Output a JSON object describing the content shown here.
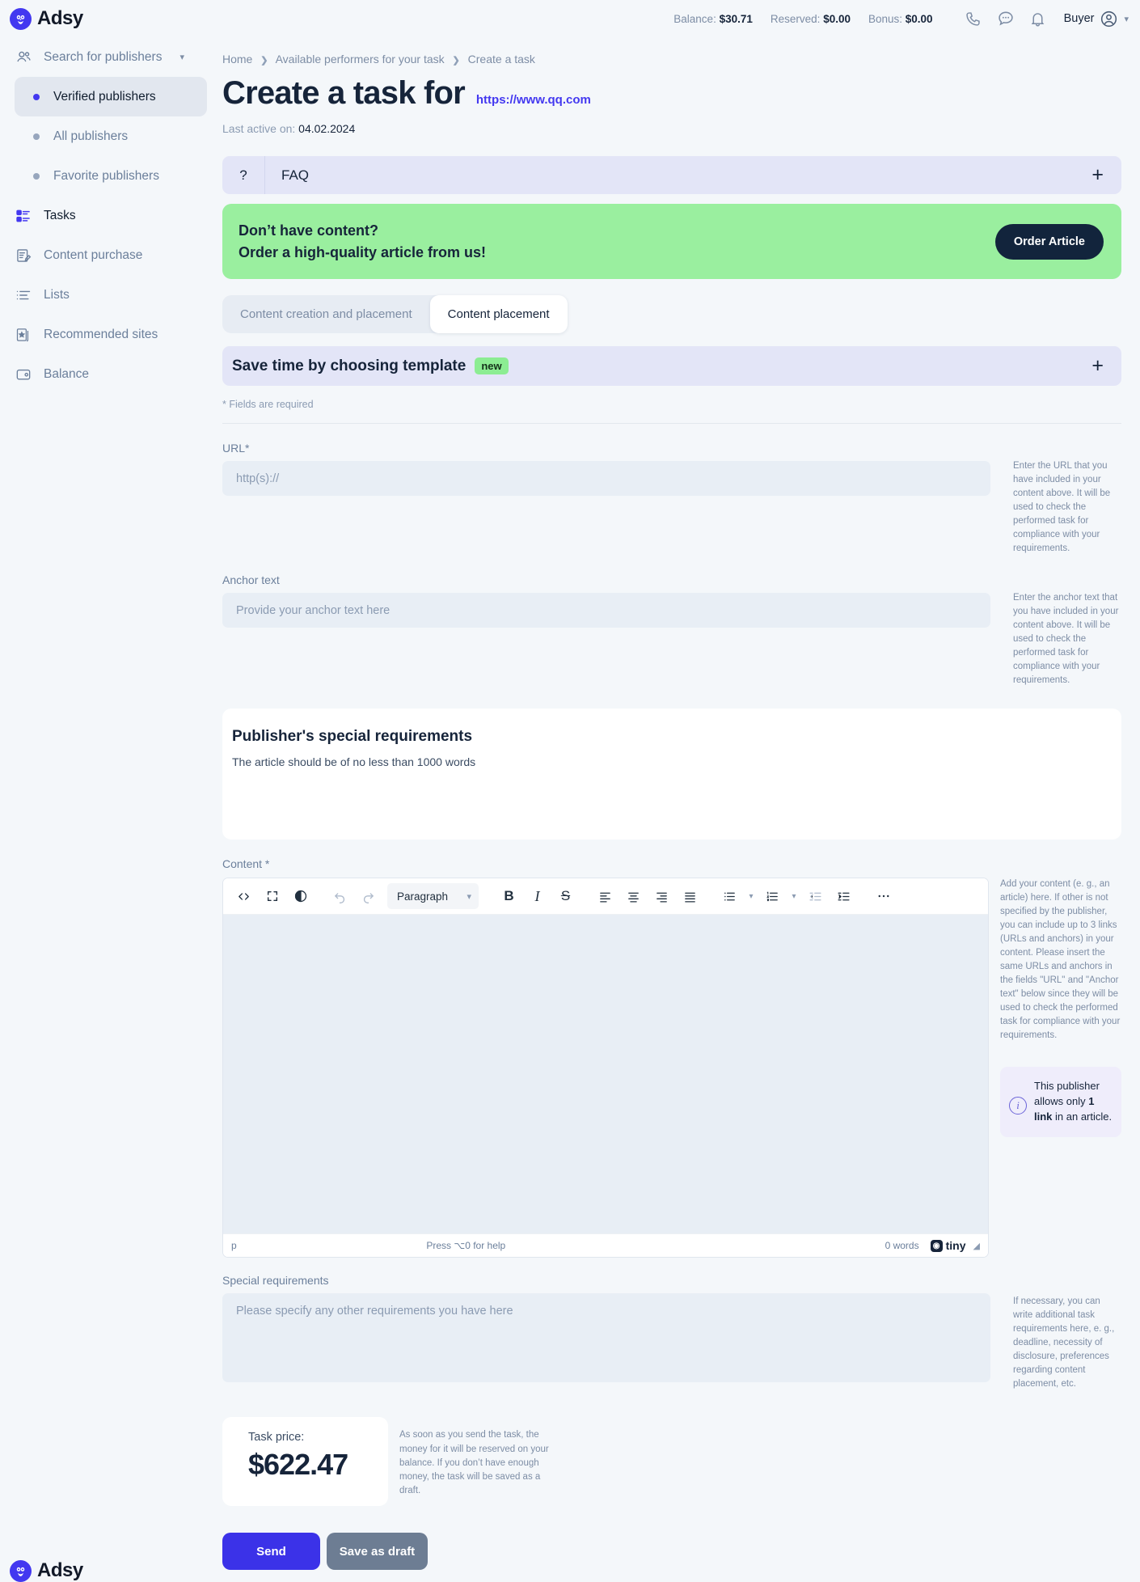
{
  "app": {
    "brand": "Adsy",
    "logo_icon": "owl-logo-icon"
  },
  "header": {
    "balance_label": "Balance:",
    "balance_value": "$30.71",
    "reserved_label": "Reserved:",
    "reserved_value": "$0.00",
    "bonus_label": "Bonus:",
    "bonus_value": "$0.00",
    "phone_icon": "phone-icon",
    "chat_icon": "chat-bubble-icon",
    "bell_icon": "bell-icon",
    "role": "Buyer",
    "avatar_icon": "user-avatar-icon",
    "chevron": "chevron-down-icon"
  },
  "sidebar": {
    "search": {
      "label": "Search for publishers",
      "icon": "users-icon",
      "chevron": "chevron-down-icon"
    },
    "sub_items": [
      {
        "label": "Verified publishers",
        "active": true
      },
      {
        "label": "All publishers",
        "active": false
      },
      {
        "label": "Favorite publishers",
        "active": false
      }
    ],
    "items": [
      {
        "label": "Tasks",
        "icon": "tasks-icon"
      },
      {
        "label": "Content purchase",
        "icon": "document-edit-icon"
      },
      {
        "label": "Lists",
        "icon": "list-icon"
      },
      {
        "label": "Recommended sites",
        "icon": "star-page-icon"
      },
      {
        "label": "Balance",
        "icon": "wallet-icon"
      }
    ]
  },
  "breadcrumb": {
    "items": [
      "Home",
      "Available performers for your task",
      "Create a task"
    ],
    "separator": "❯"
  },
  "page": {
    "title": "Create a task for",
    "site_url": "https://www.qq.com",
    "last_active_label": "Last active on:",
    "last_active_value": "04.02.2024"
  },
  "faq": {
    "question_mark": "?",
    "label": "FAQ",
    "expand_icon": "plus-icon",
    "expand": "+"
  },
  "banner": {
    "line1": "Don’t have content?",
    "line2": "Order a high-quality article from us!",
    "button": "Order Article"
  },
  "tabs": [
    {
      "label": "Content creation and placement",
      "active": false
    },
    {
      "label": "Content placement",
      "active": true
    }
  ],
  "template_bar": {
    "label": "Save time by choosing template",
    "badge": "new",
    "expand": "+"
  },
  "required_note": "* Fields are required",
  "fields": {
    "url": {
      "label": "URL*",
      "placeholder": "http(s)://",
      "value": "",
      "hint": "Enter the URL that you have included in your content above. It will be used to check the performed task for compliance with your requirements."
    },
    "anchor": {
      "label": "Anchor text",
      "placeholder": "Provide your anchor text here",
      "value": "",
      "hint": "Enter the anchor text that you have included in your content above. It will be used to check the performed task for compliance with your requirements."
    },
    "special": {
      "label": "Special requirements",
      "placeholder": "Please specify any other requirements you have here",
      "value": "",
      "hint": "If necessary, you can write additional task requirements here, e. g., deadline, necessity of disclosure, preferences regarding content placement, etc."
    }
  },
  "publisher_requirements": {
    "title": "Publisher's special requirements",
    "text": "The article should be of no less than 1000 words"
  },
  "content": {
    "label": "Content *",
    "hint": "Add your content (e. g., an article) here. If other is not specified by the publisher, you can include up to 3 links (URLs and anchors) in your content. Please insert the same URLs and anchors in the fields \"URL\" and \"Anchor text\" below since they will be used to check the performed task for compliance with your requirements.",
    "info_box": {
      "icon": "info-icon",
      "text_before": "This publisher allows only ",
      "text_bold": "1 link",
      "text_after": " in an article."
    }
  },
  "editor": {
    "toolbar": [
      {
        "name": "source-code-icon",
        "glyph": "‹›"
      },
      {
        "name": "fullscreen-icon",
        "glyph": "⛶"
      },
      {
        "name": "preview-icon",
        "glyph": "◉"
      },
      {
        "name": "undo-icon",
        "glyph": "↶"
      },
      {
        "name": "redo-icon",
        "glyph": "↷"
      },
      {
        "name": "bold-icon",
        "glyph": "B"
      },
      {
        "name": "italic-icon",
        "glyph": "I"
      },
      {
        "name": "strikethrough-icon",
        "glyph": "S"
      },
      {
        "name": "align-left-icon",
        "glyph": "≡"
      },
      {
        "name": "align-center-icon",
        "glyph": "≡"
      },
      {
        "name": "align-right-icon",
        "glyph": "≡"
      },
      {
        "name": "align-justify-icon",
        "glyph": "≡"
      },
      {
        "name": "bullet-list-icon",
        "glyph": "•≡"
      },
      {
        "name": "numbered-list-icon",
        "glyph": "1≡"
      },
      {
        "name": "outdent-icon",
        "glyph": "⇤"
      },
      {
        "name": "indent-icon",
        "glyph": "⇥"
      },
      {
        "name": "more-icon",
        "glyph": "•••"
      }
    ],
    "format_select": "Paragraph",
    "body_value": "",
    "status_path": "p",
    "help_text": "Press ⌥0 for help",
    "word_count": "0 words",
    "branding": "tiny",
    "resize_handle": "resize-handle-icon"
  },
  "price": {
    "label": "Task price:",
    "value": "$622.47",
    "note": "As soon as you send the task, the money for it will be reserved on your balance. If you don’t have enough money, the task will be saved as a draft."
  },
  "actions": {
    "send": "Send",
    "draft": "Save as draft"
  },
  "colors": {
    "accent": "#4338f0",
    "send": "#3b32e8",
    "draft": "#6d7d93",
    "banner_green": "#9aef9f",
    "dark": "#12243c",
    "panel": "#e3e5f7"
  }
}
